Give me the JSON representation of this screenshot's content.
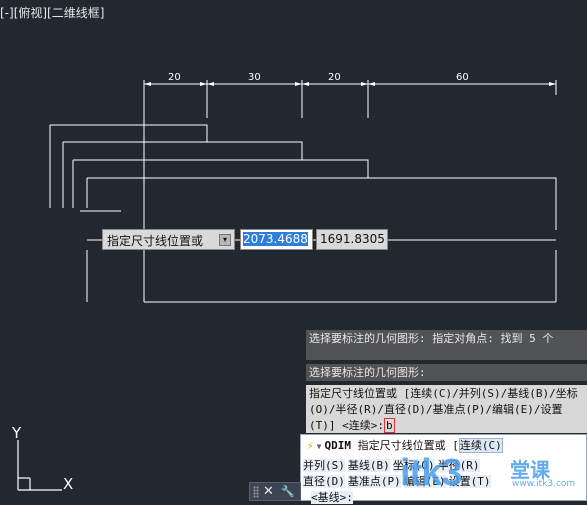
{
  "viewport": {
    "label": "[-][俯视][二维线框]"
  },
  "dimensions": [
    "20",
    "30",
    "20",
    "60"
  ],
  "dynamic_input": {
    "prompt_label": "指定尺寸线位置或",
    "prompt_arrow": "▾",
    "value_active": "2073.4688",
    "value_second": "1691.8305"
  },
  "command_history": [
    {
      "text": "选择要标注的几何图形: 指定对角点: 找到 5 个"
    },
    {
      "text": "选择要标注的几何图形:"
    }
  ],
  "command_line": {
    "text": "指定尺寸线位置或 [连续(C)/并列(S)/基线(B)/坐标(O)/半径(R)/直径(D)/基准点(P)/编辑(E)/设置(T)] <连续>:",
    "typed": "b"
  },
  "autocomplete": {
    "command": "QDIM",
    "prompt": "指定尺寸线位置或 [",
    "highlighted_option": "连续(C)",
    "rows": [
      [
        "并列(S)",
        "基线(B)",
        "坐标(O)",
        "半径(R)"
      ],
      [
        "直径(D)",
        "基准点(P)",
        "编辑(E)",
        "设置(T)"
      ],
      [
        "<基线>:"
      ]
    ]
  },
  "toolbar": {
    "close_glyph": "✕",
    "settings_glyph": "🔧"
  },
  "ucs": {
    "x_label": "X",
    "y_label": "Y"
  },
  "watermark": {
    "brand": "itk3",
    "cn": "堂课",
    "url": "www.itk3.com"
  }
}
